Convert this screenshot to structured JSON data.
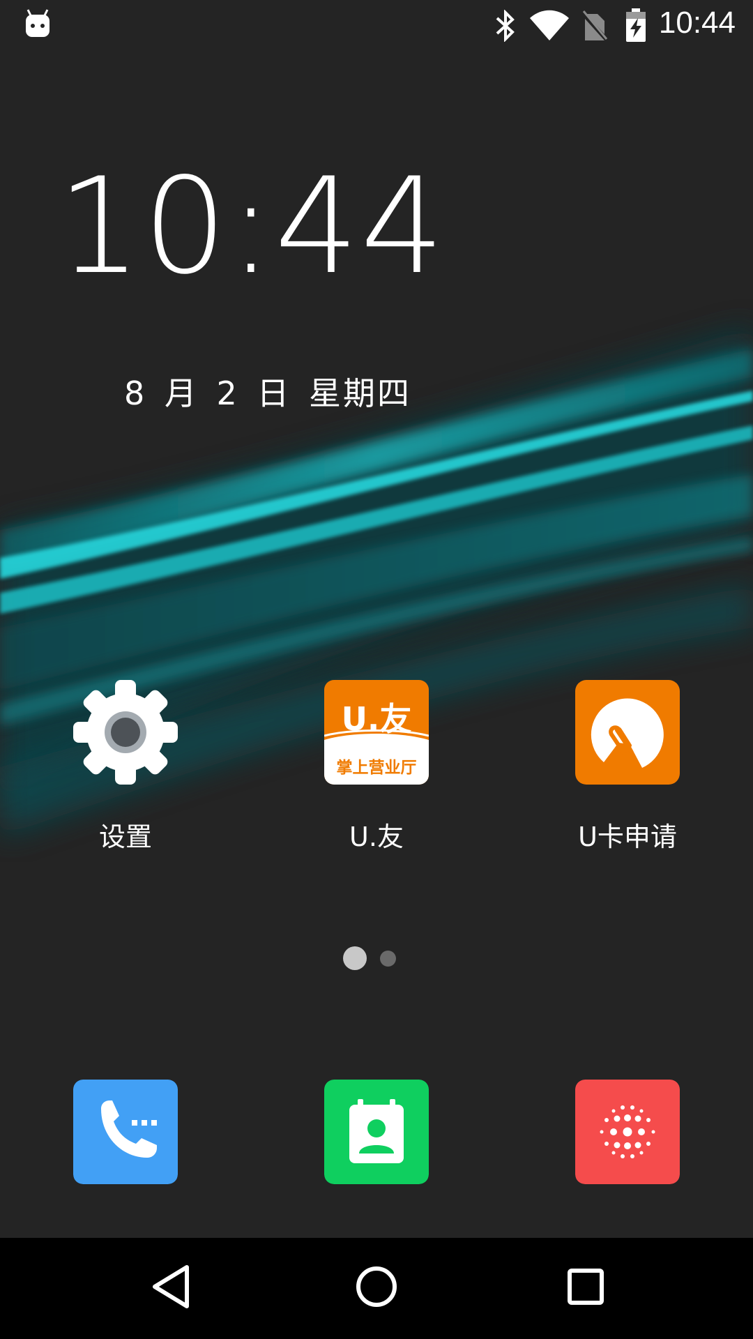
{
  "status_bar": {
    "time": "10:44",
    "icons": [
      "android-debug-icon",
      "bluetooth-icon",
      "wifi-icon",
      "no-sim-icon",
      "battery-charging-icon"
    ]
  },
  "clock_widget": {
    "time": "10:44",
    "date": "8 月 2 日  星期四"
  },
  "apps": [
    {
      "label": "设置",
      "icon": "settings-gear-icon"
    },
    {
      "label": "U.友",
      "icon": "uyou-icon",
      "icon_text_top": "U.友",
      "icon_text_bottom": "掌上营业厅"
    },
    {
      "label": "U卡申请",
      "icon": "ucard-apply-icon"
    }
  ],
  "page_indicator": {
    "pages": 2,
    "current": 1
  },
  "dock": [
    {
      "icon": "phone-icon",
      "color": "#42a0f5"
    },
    {
      "icon": "contacts-icon",
      "color": "#0fcf5f"
    },
    {
      "icon": "app-drawer-icon",
      "color": "#f54c4c"
    }
  ],
  "navbar": [
    "back-icon",
    "home-icon",
    "recents-icon"
  ],
  "colors": {
    "accent_orange": "#f07b00",
    "wallpaper_teal": "#1ec8cf"
  }
}
